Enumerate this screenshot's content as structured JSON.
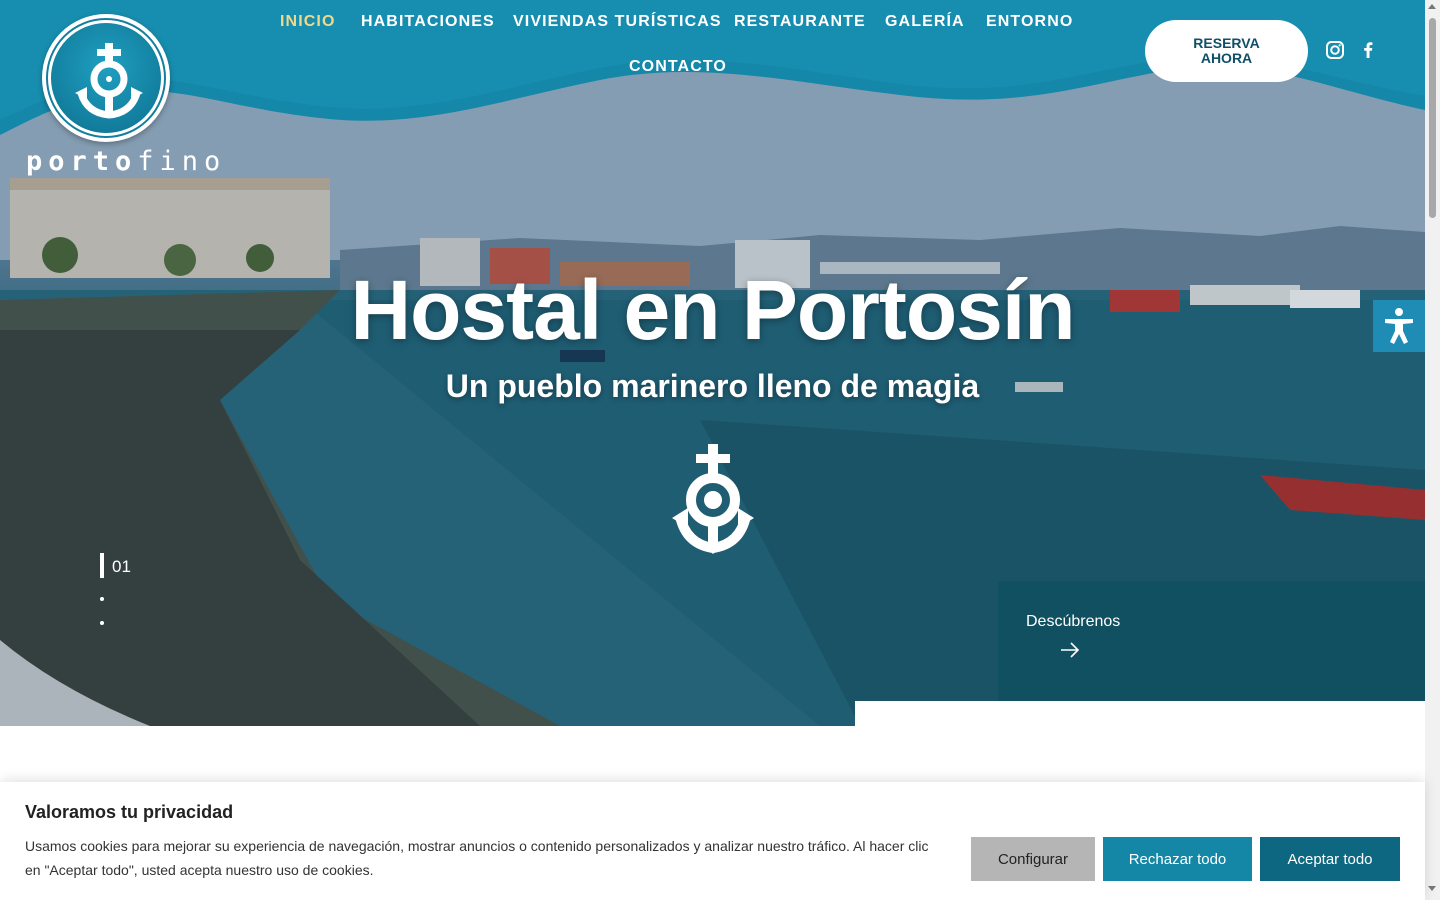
{
  "header": {
    "logo_text_bold": "porto",
    "logo_text_thin": "fino",
    "nav": [
      {
        "label": "INICIO",
        "active": true
      },
      {
        "label": "HABITACIONES"
      },
      {
        "label": "VIVIENDAS TURÍSTICAS"
      },
      {
        "label": "RESTAURANTE"
      },
      {
        "label": "GALERÍA"
      },
      {
        "label": "ENTORNO"
      },
      {
        "label": "CONTACTO"
      }
    ],
    "reserve_line1": "RESERVA",
    "reserve_line2": "AHORA",
    "social": [
      "instagram-icon",
      "facebook-icon"
    ]
  },
  "hero": {
    "title": "Hostal en Portosín",
    "subtitle": "Un pueblo marinero lleno de magia",
    "slide_number": "01",
    "discover_label": "Descúbrenos"
  },
  "cookie": {
    "title": "Valoramos tu privacidad",
    "text": "Usamos cookies para mejorar su experiencia de navegación, mostrar anuncios o contenido personalizados y analizar nuestro tráfico. Al hacer clic en \"Aceptar todo\", usted acepta nuestro uso de cookies.",
    "configure_label": "Configurar",
    "reject_label": "Rechazar todo",
    "accept_label": "Aceptar todo"
  },
  "colors": {
    "brand_teal": "#1486a6",
    "brand_dark": "#0e6780",
    "nav_active": "#f0d98a"
  }
}
